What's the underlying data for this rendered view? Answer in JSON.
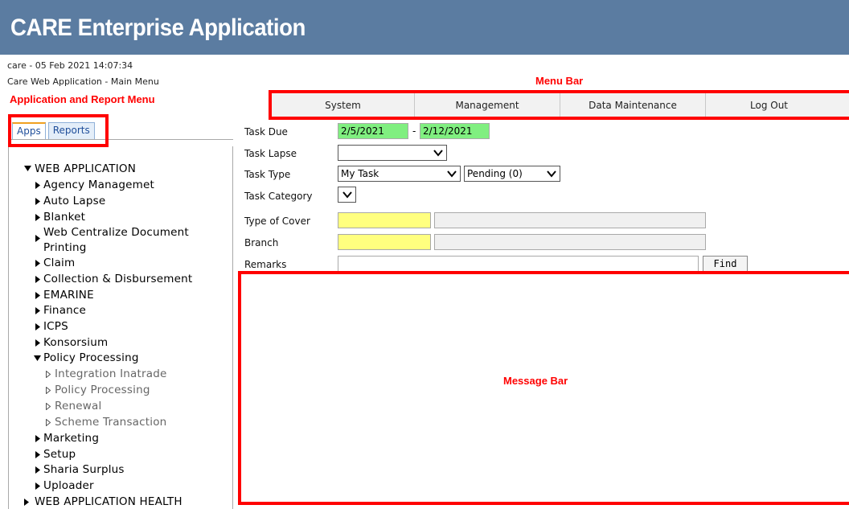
{
  "header": {
    "title": "CARE Enterprise Application"
  },
  "info": {
    "session": "care - 05 Feb 2021 14:07:34",
    "location": "Care Web Application - Main Menu"
  },
  "annotations": {
    "app_menu": "Application and Report Menu",
    "menu_bar": "Menu Bar",
    "message_bar": "Message Bar"
  },
  "tabs": {
    "apps": "Apps",
    "reports": "Reports"
  },
  "menu": {
    "system": "System",
    "management": "Management",
    "data_maintenance": "Data Maintenance",
    "logout": "Log Out"
  },
  "tree": {
    "web_application": "WEB APPLICATION",
    "items": [
      "Agency Managemet",
      "Auto Lapse",
      "Blanket",
      "Web Centralize Document",
      "Printing",
      "Claim",
      "Collection & Disbursement",
      "EMARINE",
      "Finance",
      "ICPS",
      "Konsorsium",
      "Policy Processing",
      "Marketing",
      "Setup",
      "Sharia Surplus",
      "Uploader"
    ],
    "sub_items": [
      "Integration Inatrade",
      "Policy Processing",
      "Renewal",
      "Scheme Transaction"
    ],
    "web_application_health": "WEB APPLICATION HEALTH"
  },
  "form": {
    "task_due_label": "Task Due",
    "task_due_from": "2/5/2021",
    "task_due_to": "2/12/2021",
    "task_lapse_label": "Task Lapse",
    "task_lapse_value": "",
    "task_type_label": "Task Type",
    "task_type_value": "My Task",
    "task_status_value": "Pending (0)",
    "task_category_label": "Task Category",
    "type_of_cover_label": "Type of Cover",
    "branch_label": "Branch",
    "remarks_label": "Remarks",
    "find_label": "Find"
  },
  "colors": {
    "header_bg": "#5b7ca1",
    "annotation_red": "#ff0000",
    "date_green": "#80ef80",
    "required_yellow": "#ffff7f"
  }
}
